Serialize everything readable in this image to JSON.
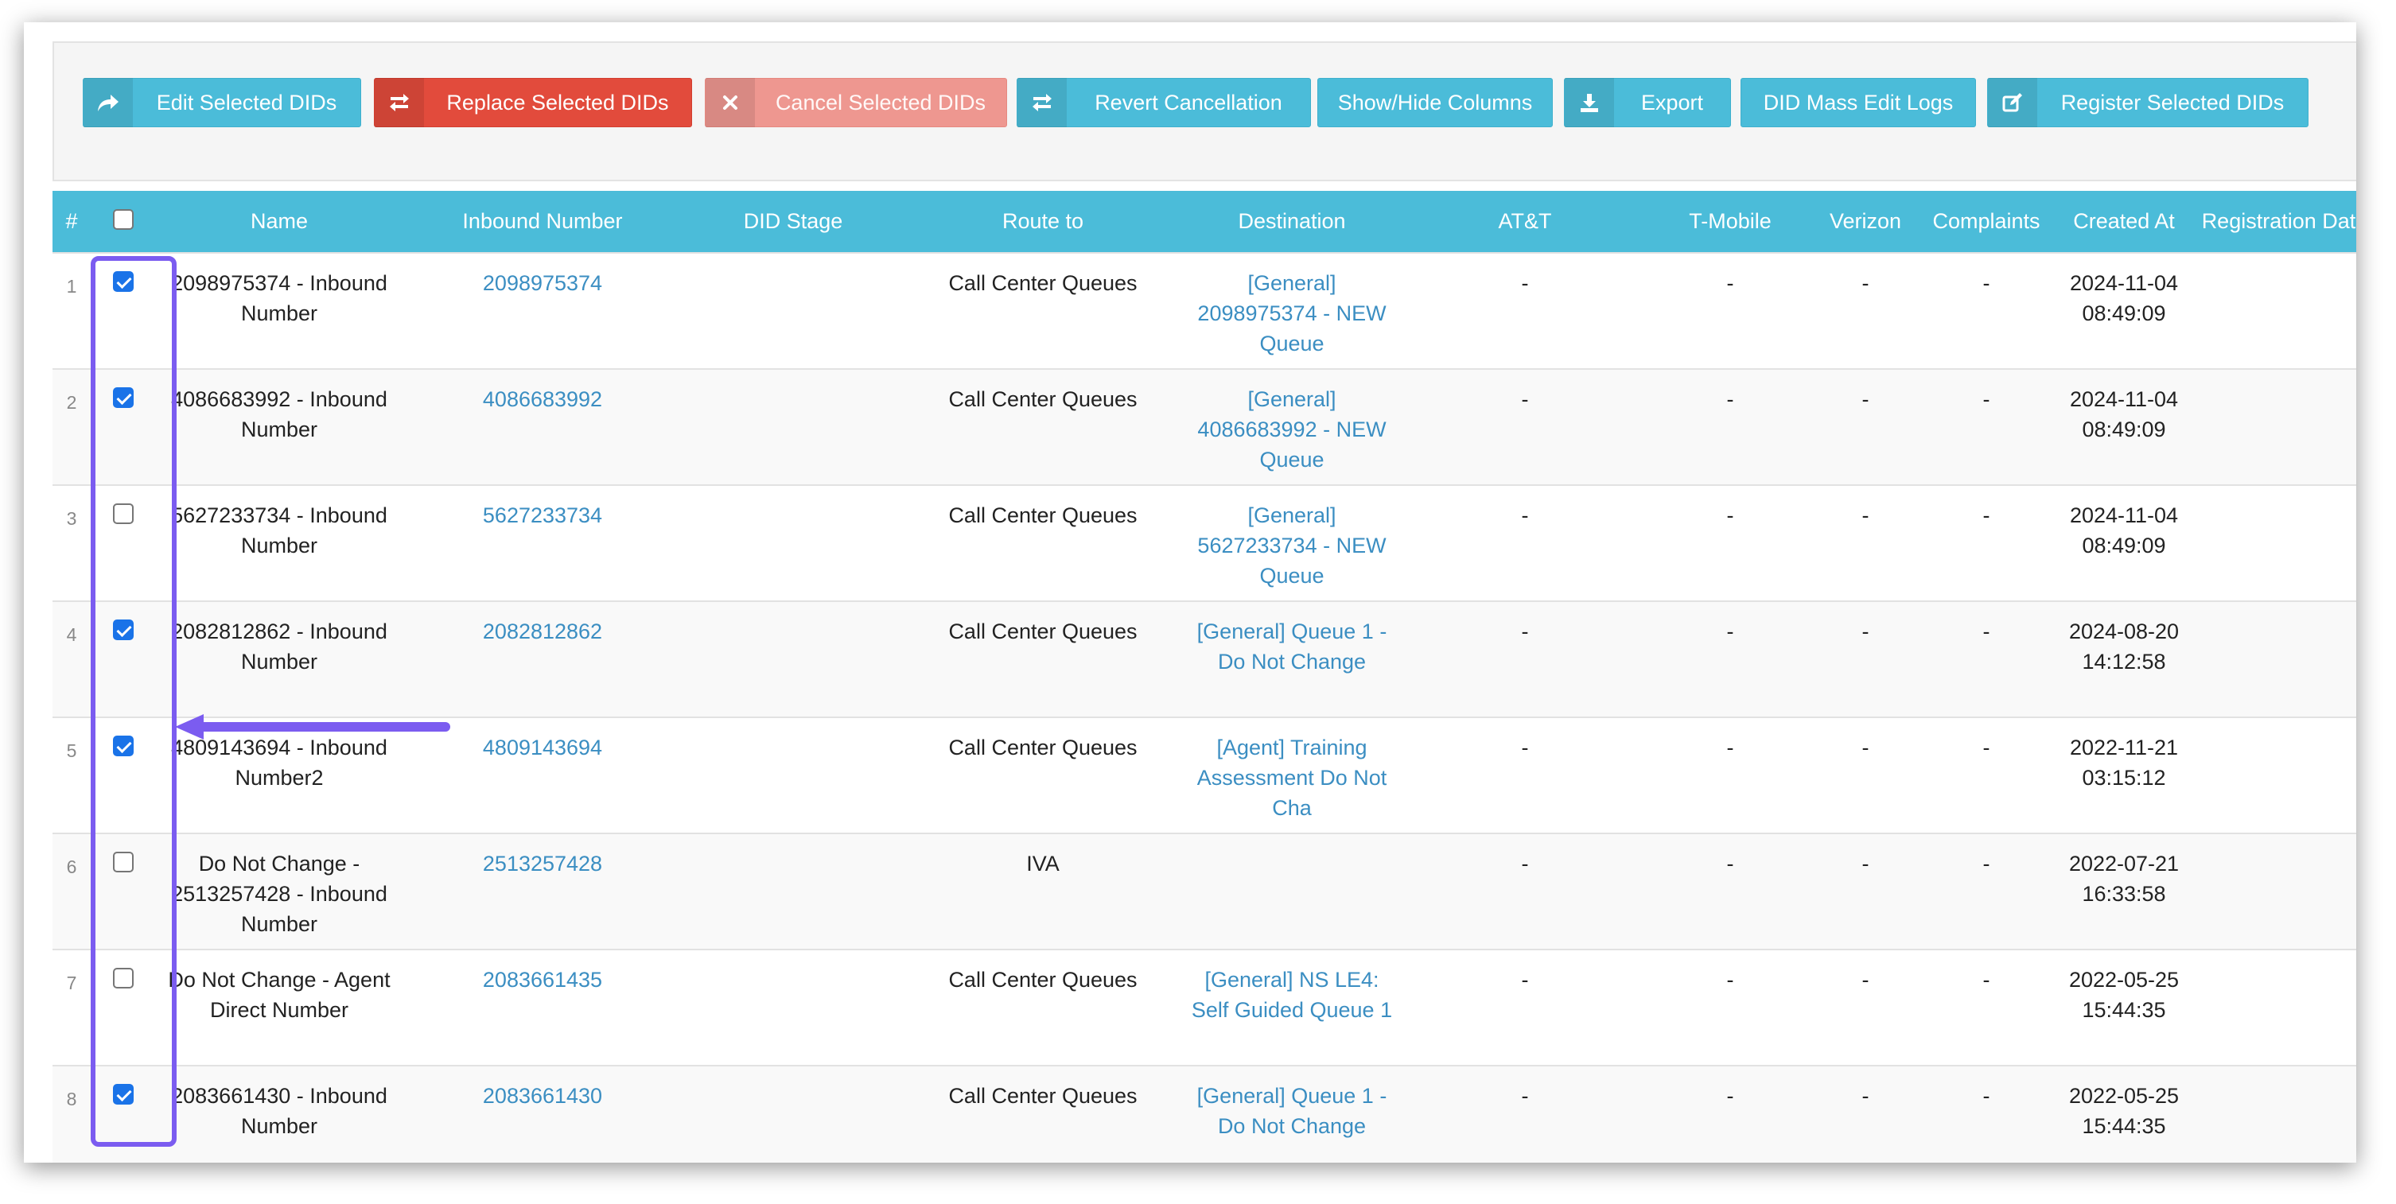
{
  "toolbar": {
    "buttons": [
      {
        "label": "Edit Selected DIDs",
        "icon": "share-arrow-icon"
      },
      {
        "label": "Replace Selected DIDs",
        "icon": "swap-icon"
      },
      {
        "label": "Cancel Selected DIDs",
        "icon": "close-x-icon"
      },
      {
        "label": "Revert Cancellation",
        "icon": "swap-icon"
      },
      {
        "label": "Show/Hide Columns"
      },
      {
        "label": "Export",
        "icon": "download-icon"
      },
      {
        "label": "DID Mass Edit Logs"
      },
      {
        "label": "Register Selected DIDs",
        "icon": "edit-icon"
      }
    ]
  },
  "table": {
    "columns": {
      "index": "#",
      "name": "Name",
      "inbound": "Inbound Number",
      "stage": "DID Stage",
      "route": "Route to",
      "destination": "Destination",
      "att": "AT&T",
      "tmobile": "T-Mobile",
      "verizon": "Verizon",
      "complaints": "Complaints",
      "created": "Created At",
      "registration": "Registration Date"
    },
    "select_all_checked": false,
    "rows": [
      {
        "index": "1",
        "checked": true,
        "name": "2098975374 - Inbound Number",
        "inbound": "2098975374",
        "stage": "",
        "route": "Call Center Queues",
        "destination": "[General] 2098975374 - NEW Queue",
        "att": "-",
        "tmobile": "-",
        "verizon": "-",
        "complaints": "-",
        "created": "2024-11-04 08:49:09",
        "registration": ""
      },
      {
        "index": "2",
        "checked": true,
        "name": "4086683992 - Inbound Number",
        "inbound": "4086683992",
        "stage": "",
        "route": "Call Center Queues",
        "destination": "[General] 4086683992 - NEW Queue",
        "att": "-",
        "tmobile": "-",
        "verizon": "-",
        "complaints": "-",
        "created": "2024-11-04 08:49:09",
        "registration": ""
      },
      {
        "index": "3",
        "checked": false,
        "name": "5627233734 - Inbound Number",
        "inbound": "5627233734",
        "stage": "",
        "route": "Call Center Queues",
        "destination": "[General] 5627233734 - NEW Queue",
        "att": "-",
        "tmobile": "-",
        "verizon": "-",
        "complaints": "-",
        "created": "2024-11-04 08:49:09",
        "registration": ""
      },
      {
        "index": "4",
        "checked": true,
        "name": "2082812862 - Inbound Number",
        "inbound": "2082812862",
        "stage": "",
        "route": "Call Center Queues",
        "destination": "[General] Queue 1 - Do Not Change",
        "att": "-",
        "tmobile": "-",
        "verizon": "-",
        "complaints": "-",
        "created": "2024-08-20 14:12:58",
        "registration": ""
      },
      {
        "index": "5",
        "checked": true,
        "name": "4809143694 - Inbound Number2",
        "inbound": "4809143694",
        "stage": "",
        "route": "Call Center Queues",
        "destination": "[Agent] Training Assessment Do Not Cha",
        "att": "-",
        "tmobile": "-",
        "verizon": "-",
        "complaints": "-",
        "created": "2022-11-21 03:15:12",
        "registration": ""
      },
      {
        "index": "6",
        "checked": false,
        "name": "Do Not Change - 2513257428 - Inbound Number",
        "inbound": "2513257428",
        "stage": "",
        "route": "IVA",
        "destination": "",
        "att": "-",
        "tmobile": "-",
        "verizon": "-",
        "complaints": "-",
        "created": "2022-07-21 16:33:58",
        "registration": ""
      },
      {
        "index": "7",
        "checked": false,
        "name": "Do Not Change - Agent Direct Number",
        "inbound": "2083661435",
        "stage": "",
        "route": "Call Center Queues",
        "destination": "[General] NS LE4: Self Guided Queue 1",
        "att": "-",
        "tmobile": "-",
        "verizon": "-",
        "complaints": "-",
        "created": "2022-05-25 15:44:35",
        "registration": ""
      },
      {
        "index": "8",
        "checked": true,
        "name": "2083661430 - Inbound Number",
        "inbound": "2083661430",
        "stage": "",
        "route": "Call Center Queues",
        "destination": "[General] Queue 1 - Do Not Change",
        "att": "-",
        "tmobile": "-",
        "verizon": "-",
        "complaints": "-",
        "created": "2022-05-25 15:44:35",
        "registration": ""
      }
    ]
  },
  "annotation": {
    "color": "#7b5cf0"
  }
}
